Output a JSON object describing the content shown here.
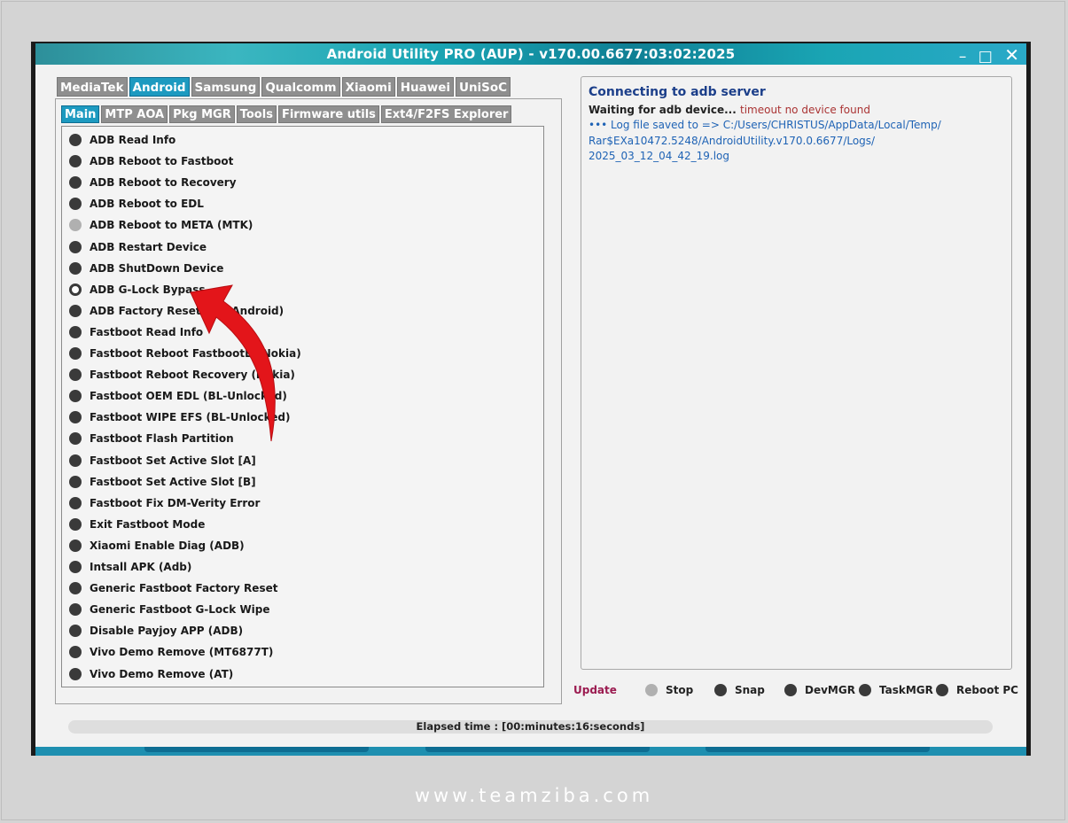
{
  "window": {
    "title": "Android Utility PRO (AUP) - v170.00.6677:03:02:2025",
    "controls": {
      "minimize": "–",
      "maximize": "□",
      "close": "✕"
    }
  },
  "brand_tabs": [
    {
      "label": "MediaTek",
      "active": false
    },
    {
      "label": "Android",
      "active": true
    },
    {
      "label": "Samsung",
      "active": false
    },
    {
      "label": "Qualcomm",
      "active": false
    },
    {
      "label": "Xiaomi",
      "active": false
    },
    {
      "label": "Huawei",
      "active": false
    },
    {
      "label": "UniSoC",
      "active": false
    }
  ],
  "sub_tabs": [
    {
      "label": "Main",
      "active": true
    },
    {
      "label": "MTP AOA",
      "active": false
    },
    {
      "label": "Pkg MGR",
      "active": false
    },
    {
      "label": "Tools",
      "active": false
    },
    {
      "label": "Firmware utils",
      "active": false
    },
    {
      "label": "Ext4/F2FS Explorer",
      "active": false
    }
  ],
  "functions": [
    {
      "label": "ADB Read Info",
      "state": "normal"
    },
    {
      "label": "ADB Reboot to Fastboot",
      "state": "normal"
    },
    {
      "label": "ADB Reboot to Recovery",
      "state": "normal"
    },
    {
      "label": "ADB Reboot to EDL",
      "state": "normal"
    },
    {
      "label": "ADB Reboot to META (MTK)",
      "state": "disabled"
    },
    {
      "label": "ADB Restart Device",
      "state": "normal"
    },
    {
      "label": "ADB ShutDown Device",
      "state": "normal"
    },
    {
      "label": "ADB G-Lock Bypass",
      "state": "selected"
    },
    {
      "label": "ADB Factory Reset (old Android)",
      "state": "normal"
    },
    {
      "label": "Fastboot Read Info",
      "state": "normal"
    },
    {
      "label": "Fastboot Reboot FastbootD (Nokia)",
      "state": "normal"
    },
    {
      "label": "Fastboot Reboot Recovery (Nokia)",
      "state": "normal"
    },
    {
      "label": "Fastboot OEM EDL (BL-Unlocked)",
      "state": "normal"
    },
    {
      "label": "Fastboot WIPE EFS (BL-Unlocked)",
      "state": "normal"
    },
    {
      "label": "Fastboot Flash Partition",
      "state": "normal"
    },
    {
      "label": "Fastboot Set Active Slot [A]",
      "state": "normal"
    },
    {
      "label": "Fastboot Set Active Slot [B]",
      "state": "normal"
    },
    {
      "label": "Fastboot Fix DM-Verity Error",
      "state": "normal"
    },
    {
      "label": "Exit Fastboot Mode",
      "state": "normal"
    },
    {
      "label": "Xiaomi Enable Diag (ADB)",
      "state": "normal"
    },
    {
      "label": "Intsall APK (Adb)",
      "state": "normal"
    },
    {
      "label": "Generic Fastboot Factory Reset",
      "state": "normal"
    },
    {
      "label": "Generic Fastboot G-Lock Wipe",
      "state": "normal"
    },
    {
      "label": "Disable Payjoy APP (ADB)",
      "state": "normal"
    },
    {
      "label": "Vivo Demo Remove (MT6877T)",
      "state": "normal"
    },
    {
      "label": "Vivo Demo Remove (AT)",
      "state": "normal"
    }
  ],
  "log": {
    "title": "Connecting to adb server",
    "waiting": "Waiting for adb device...",
    "timeout": "timeout no device found",
    "path_line1": "••• Log file saved to => C:/Users/CHRISTUS/AppData/Local/Temp/",
    "path_line2": "Rar$EXa10472.5248/AndroidUtility.v170.0.6677/Logs/",
    "path_line3": "2025_03_12_04_42_19.log"
  },
  "actions": {
    "update": "Update",
    "stop": "Stop",
    "snap": "Snap",
    "devmgr": "DevMGR",
    "taskmgr": "TaskMGR",
    "reboot_pc": "Reboot PC"
  },
  "status": {
    "elapsed": "Elapsed time : [00:minutes:16:seconds]"
  },
  "watermark": "www.teamziba.com",
  "colors": {
    "accent": "#1d9ac0",
    "title_gradient": "#1aa5b4",
    "arrow": "#e3151a",
    "update_text": "#9b1b50"
  }
}
